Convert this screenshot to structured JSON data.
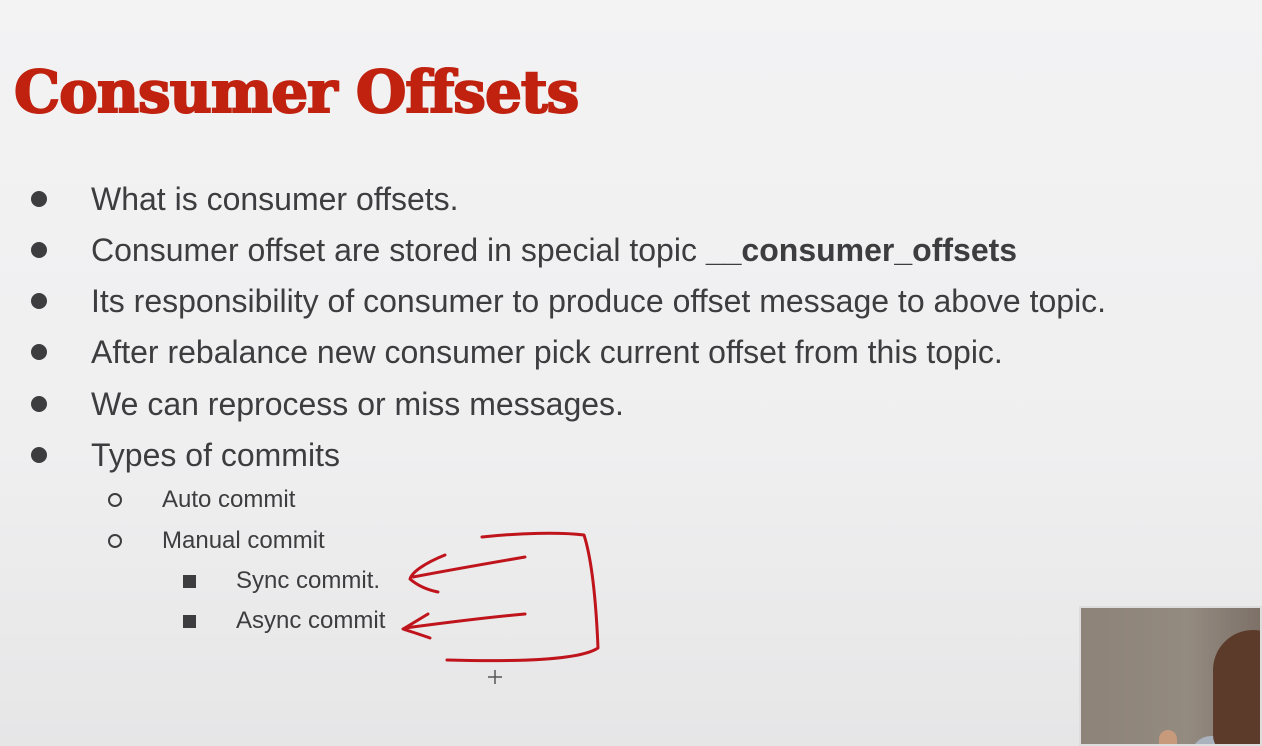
{
  "slide": {
    "title": "Consumer Offsets",
    "bullets": [
      {
        "text": "What is consumer offsets."
      },
      {
        "text": "Consumer offset are stored in special topic ",
        "bold": "__consumer_offsets"
      },
      {
        "text": "Its responsibility of consumer to produce offset message to above topic."
      },
      {
        "text": "After rebalance new consumer pick current offset from this topic."
      },
      {
        "text": "We can reprocess or miss messages."
      },
      {
        "text": "Types of commits"
      }
    ],
    "sub_bullets": [
      "Auto commit",
      "Manual commit"
    ],
    "sub_sub_bullets": [
      "Sync commit.",
      "Async commit"
    ]
  },
  "colors": {
    "title": "#c0220f",
    "text": "#3d3d3f",
    "annotation": "#c0141c"
  }
}
